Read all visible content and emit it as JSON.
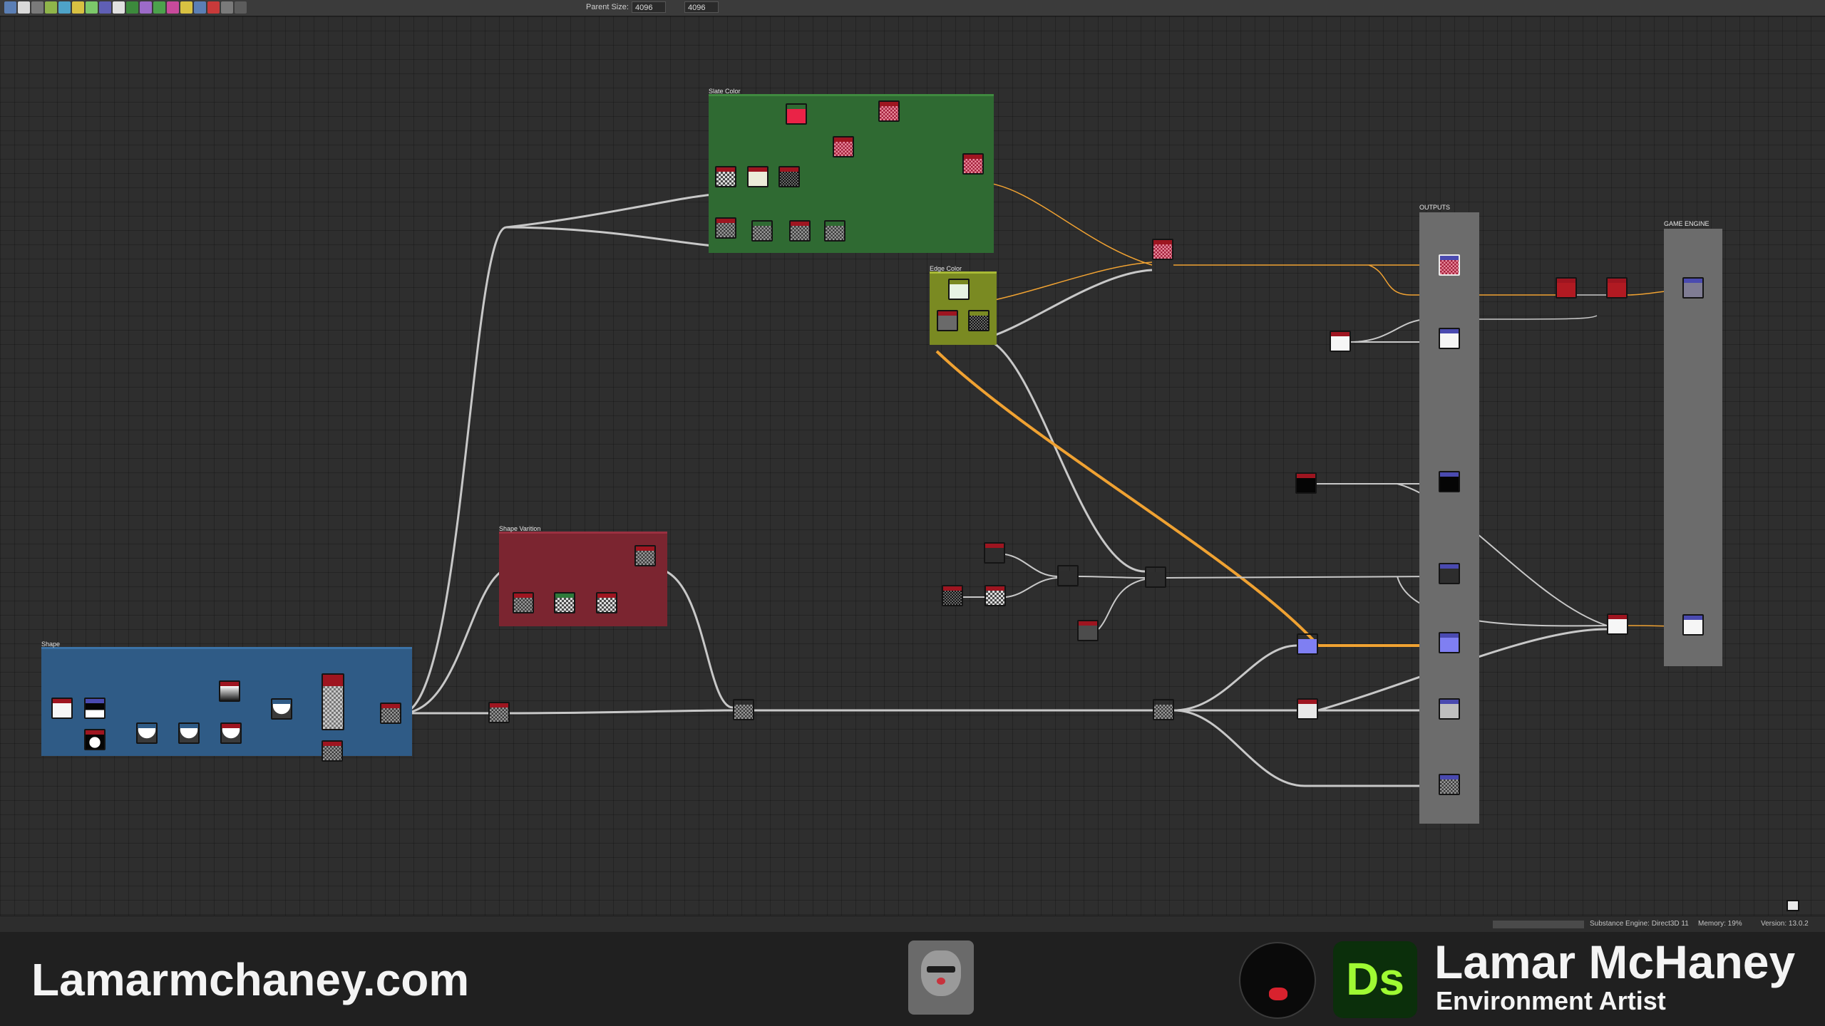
{
  "toolbar": {
    "parent_size_label": "Parent Size:",
    "parent_size_value": "4096",
    "size_value_2": "4096"
  },
  "frames": {
    "slate_color": "Slate Color",
    "edge_color": "Edge Color",
    "shape_variation": "Shape Varition",
    "shape": "Shape",
    "outputs": "OUTPUTS",
    "game_engine": "GAME ENGINE"
  },
  "statusbar": {
    "engine": "Substance Engine: Direct3D 11",
    "memory": "Memory: 19%",
    "version": "Version: 13.0.2"
  },
  "banner": {
    "website": "Lamarmchaney.com",
    "app_badge": "Ds",
    "name": "Lamar McHaney",
    "role": "Environment Artist"
  },
  "colors": {
    "slate_frame": "#2f6a32",
    "edge_frame": "#7a8a22",
    "shape_variation_frame": "#7b2530",
    "shape_frame": "#2f5b86",
    "wire": "#c8c8c8",
    "wire_color": "#f0a232",
    "app_badge_bg": "#0b2f0b",
    "app_badge_fg": "#9ffa33"
  },
  "icons": [
    "node-graph-toolbar-icons",
    "clapperboard-icon",
    "avatar-portrait",
    "brand-logo-icon"
  ]
}
